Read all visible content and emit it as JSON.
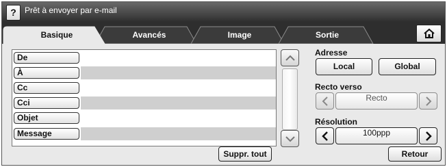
{
  "status": {
    "text": "Prêt à envoyer par e-mail",
    "help_label": "?"
  },
  "tabs": [
    {
      "label": "Basique",
      "active": true
    },
    {
      "label": "Avancés",
      "active": false
    },
    {
      "label": "Image",
      "active": false
    },
    {
      "label": "Sortie",
      "active": false
    }
  ],
  "fields": [
    {
      "label": "De"
    },
    {
      "label": "À"
    },
    {
      "label": "Cc"
    },
    {
      "label": "Cci"
    },
    {
      "label": "Objet"
    },
    {
      "label": "Message"
    }
  ],
  "buttons": {
    "clear_all": "Suppr. tout",
    "back": "Retour"
  },
  "address": {
    "label": "Adresse",
    "local": "Local",
    "global": "Global"
  },
  "duplex": {
    "label": "Recto verso",
    "value": "Recto"
  },
  "resolution": {
    "label": "Résolution",
    "value": "100ppp"
  },
  "icons": {
    "help": "question-icon",
    "home": "home-icon",
    "scroll_up": "chevron-up-icon",
    "scroll_down": "chevron-down-icon",
    "prev": "chevron-left-icon",
    "next": "chevron-right-icon"
  }
}
